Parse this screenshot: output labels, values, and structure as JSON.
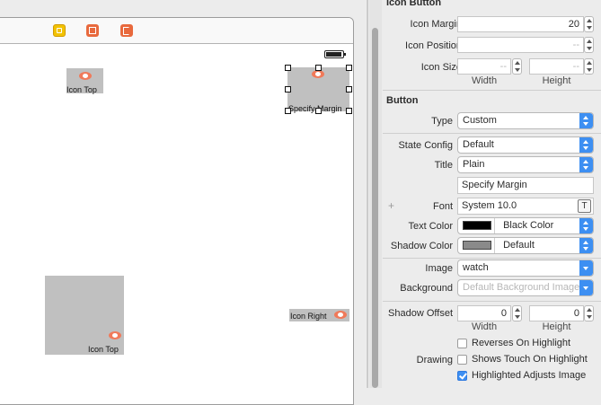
{
  "canvas": {
    "buttons": [
      {
        "label": "Icon Top"
      },
      {
        "label": "Specify Margin"
      },
      {
        "label": "Icon Top"
      },
      {
        "label": "Icon Right"
      }
    ]
  },
  "inspector": {
    "icon_button": {
      "title": "Icon Button",
      "icon_margin_label": "Icon Margin",
      "icon_margin_value": "20",
      "icon_position_label": "Icon Position",
      "icon_position_placeholder": "--",
      "icon_size_label": "Icon Size",
      "icon_size_width_placeholder": "--",
      "icon_size_height_placeholder": "--",
      "width_label": "Width",
      "height_label": "Height"
    },
    "button": {
      "title": "Button",
      "type_label": "Type",
      "type_value": "Custom",
      "state_config_label": "State Config",
      "state_config_value": "Default",
      "title_label": "Title",
      "title_type_value": "Plain",
      "title_text_value": "Specify Margin",
      "font_label": "Font",
      "font_value": "System 10.0",
      "font_button_glyph": "T",
      "plus_glyph": "+",
      "text_color_label": "Text Color",
      "text_color_value": "Black Color",
      "text_color_swatch": "#000000",
      "shadow_color_label": "Shadow Color",
      "shadow_color_value": "Default",
      "shadow_color_swatch": "#8a8a8a",
      "image_label": "Image",
      "image_value": "watch",
      "background_label": "Background",
      "background_placeholder": "Default Background Image",
      "shadow_offset_label": "Shadow Offset",
      "shadow_offset_width": "0",
      "shadow_offset_height": "0",
      "width_label": "Width",
      "height_label": "Height",
      "drawing_label": "Drawing",
      "drawing_options": [
        {
          "label": "Reverses On Highlight",
          "checked": false
        },
        {
          "label": "Shows Touch On Highlight",
          "checked": false
        },
        {
          "label": "Highlighted Adjusts Image",
          "checked": true
        }
      ]
    }
  },
  "colors": {
    "accent": "#3d8ff2",
    "icon_tint": "#f07a5a",
    "button_bg": "#c0c0c0"
  }
}
